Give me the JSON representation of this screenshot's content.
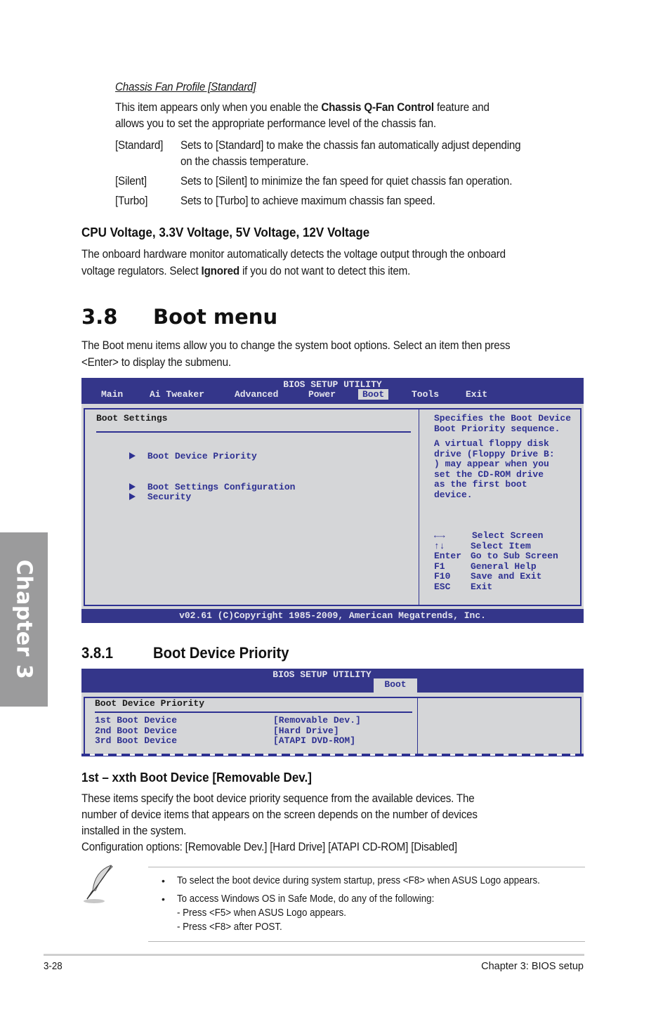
{
  "chapter_tab": {
    "label": "Chapter 3"
  },
  "chassis_fan": {
    "subtitle": "Chassis Fan Profile [Standard]",
    "intro_pre": "This item appears only when you enable the ",
    "intro_bold": "Chassis Q-Fan Control",
    "intro_post": " feature and",
    "intro_line2": "allows you to set the appropriate performance level of the chassis fan.",
    "options": [
      {
        "key": "[Standard]",
        "desc_line1": "Sets to [Standard] to make the chassis fan automatically adjust depending",
        "desc_line2": "on the chassis temperature."
      },
      {
        "key": "[Silent]",
        "desc_line1": "Sets to [Silent] to minimize the fan speed for quiet chassis fan operation."
      },
      {
        "key": "[Turbo]",
        "desc_line1": "Sets to [Turbo] to achieve maximum chassis fan speed."
      }
    ]
  },
  "voltage": {
    "heading": "CPU Voltage, 3.3V Voltage, 5V Voltage, 12V Voltage",
    "line1": "The onboard hardware monitor automatically detects the voltage output through the onboard",
    "line2_pre": "voltage regulators. Select ",
    "line2_bold": "Ignored",
    "line2_post": " if you do not want to detect this item."
  },
  "boot_menu": {
    "number": "3.8",
    "title": "Boot menu",
    "line1": "The Boot menu items allow you to change the system boot options. Select an item then press",
    "line2": "<Enter> to display the submenu."
  },
  "bios1": {
    "title": "BIOS SETUP UTILITY",
    "tabs": [
      "Main",
      "Ai Tweaker",
      "Advanced",
      "Power",
      "Boot",
      "Tools",
      "Exit"
    ],
    "active_tab": "Boot",
    "section_title": "Boot Settings",
    "items": [
      "Boot Device Priority",
      "Boot Settings Configuration",
      "Security"
    ],
    "help_lines": [
      "Specifies the Boot Device",
      "Boot Priority sequence.",
      "",
      "A virtual floppy disk",
      "drive (Floppy Drive B:",
      ") may appear when you",
      "set the CD-ROM drive",
      "as the first boot",
      "device."
    ],
    "keys": [
      {
        "key": "←→",
        "action": "Select Screen"
      },
      {
        "key": "↑↓",
        "action": "Select Item"
      },
      {
        "key": "Enter",
        "action": "Go to Sub Screen"
      },
      {
        "key": "F1",
        "action": "General Help"
      },
      {
        "key": "F10",
        "action": "Save and Exit"
      },
      {
        "key": "ESC",
        "action": "Exit"
      }
    ],
    "footer": "v02.61 (C)Copyright 1985-2009, American Megatrends, Inc."
  },
  "boot_device_priority": {
    "number": "3.8.1",
    "title": "Boot Device Priority"
  },
  "bios2": {
    "title": "BIOS SETUP UTILITY",
    "active_tab": "Boot",
    "section_title": "Boot Device Priority",
    "devices": [
      {
        "label": "1st Boot Device",
        "value": "[Removable Dev.]"
      },
      {
        "label": "2nd Boot Device",
        "value": "[Hard Drive]"
      },
      {
        "label": "3rd Boot Device",
        "value": "[ATAPI DVD-ROM]"
      }
    ]
  },
  "boot_device_item": {
    "heading": "1st – xxth Boot Device [Removable Dev.]",
    "line1": "These items specify the boot device priority sequence from the available devices. The",
    "line2": "number of device items that appears on the screen depends on the number of devices",
    "line3": "installed in the system.",
    "line4": "Configuration options: [Removable Dev.] [Hard Drive] [ATAPI CD-ROM] [Disabled]"
  },
  "note": {
    "icon": "feather-pen-icon",
    "bullet": "•",
    "items": [
      {
        "text": "To select the boot device during system startup, press <F8> when ASUS Logo appears."
      },
      {
        "text": "To access Windows OS in Safe Mode, do any of the following:",
        "sub": [
          "- Press <F5> when ASUS Logo appears.",
          "- Press <F8> after POST."
        ]
      }
    ]
  },
  "footer": {
    "page_number": "3-28",
    "chapter_title": "Chapter 3: BIOS setup"
  }
}
